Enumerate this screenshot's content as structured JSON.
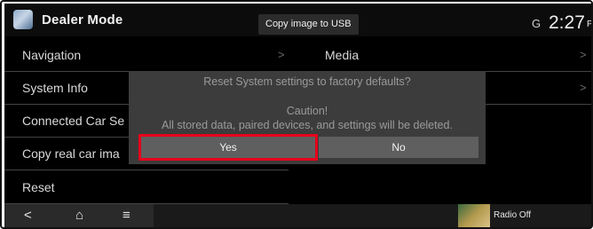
{
  "header": {
    "title": "Dealer Mode",
    "copy_button": "Copy image to USB",
    "status_icon": "G",
    "time": "2:27",
    "time_suffix": "P"
  },
  "left_menu": [
    {
      "label": "Navigation"
    },
    {
      "label": "System Info"
    },
    {
      "label": "Connected Car Se"
    },
    {
      "label": "Copy real car ima"
    },
    {
      "label": "Reset"
    }
  ],
  "right_menu": [
    {
      "label": "Media"
    },
    {
      "label": ""
    }
  ],
  "dialog": {
    "title": "Reset System settings to factory defaults?",
    "caution": "Caution!",
    "message": "All stored data, paired devices, and settings will be deleted.",
    "yes": "Yes",
    "no": "No"
  },
  "bottom_bar": {
    "back": "<",
    "home": "⌂",
    "menu": "≡",
    "media_text": "Radio Off"
  },
  "colors": {
    "highlight": "#e6001a"
  }
}
